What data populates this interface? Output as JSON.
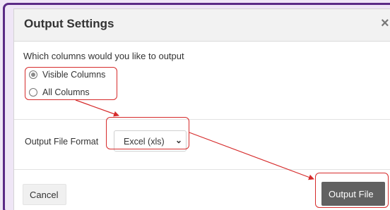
{
  "dialog": {
    "title": "Output Settings",
    "close_symbol": "×"
  },
  "columns": {
    "question": "Which columns would you like to output",
    "options": [
      {
        "label": "Visible Columns",
        "selected": true
      },
      {
        "label": "All Columns",
        "selected": false
      }
    ]
  },
  "format": {
    "label": "Output File Format",
    "selected": "Excel (xls)",
    "chevron": "⌄"
  },
  "footer": {
    "cancel_label": "Cancel",
    "output_label": "Output File"
  },
  "colors": {
    "highlight": "#d62b2b",
    "button_dark": "#616161",
    "frame": "#5b2a86"
  }
}
